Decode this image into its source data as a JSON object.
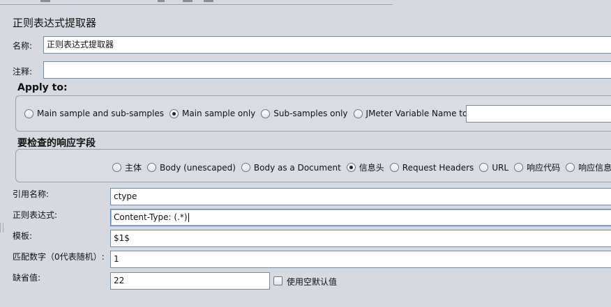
{
  "window": {
    "title": "正则表达式提取器"
  },
  "name_field": {
    "label": "名称:",
    "value": "正则表达式提取器"
  },
  "comment_field": {
    "label": "注释:",
    "value": ""
  },
  "apply_to": {
    "title": "Apply to:",
    "options": [
      {
        "label": "Main sample and sub-samples",
        "selected": false
      },
      {
        "label": "Main sample only",
        "selected": true
      },
      {
        "label": "Sub-samples only",
        "selected": false
      },
      {
        "label": "JMeter Variable Name to use",
        "selected": false
      }
    ],
    "variable_name": ""
  },
  "response_field": {
    "title": "要检查的响应字段",
    "options": [
      {
        "label": "主体",
        "selected": false
      },
      {
        "label": "Body (unescaped)",
        "selected": false
      },
      {
        "label": "Body as a Document",
        "selected": false
      },
      {
        "label": "信息头",
        "selected": true
      },
      {
        "label": "Request Headers",
        "selected": false
      },
      {
        "label": "URL",
        "selected": false
      },
      {
        "label": "响应代码",
        "selected": false
      },
      {
        "label": "响应信息",
        "selected": false
      }
    ]
  },
  "reference_name": {
    "label": "引用名称:",
    "value": "ctype"
  },
  "regex": {
    "label": "正则表达式:",
    "value": "Content-Type: (.*)"
  },
  "template": {
    "label": "模板:",
    "value": "$1$"
  },
  "match_no": {
    "label": "匹配数字（0代表随机）:",
    "value": "1"
  },
  "default_value": {
    "label": "缺省值:",
    "value": "22",
    "empty_default_label": "使用空默认值",
    "empty_default_checked": false
  }
}
